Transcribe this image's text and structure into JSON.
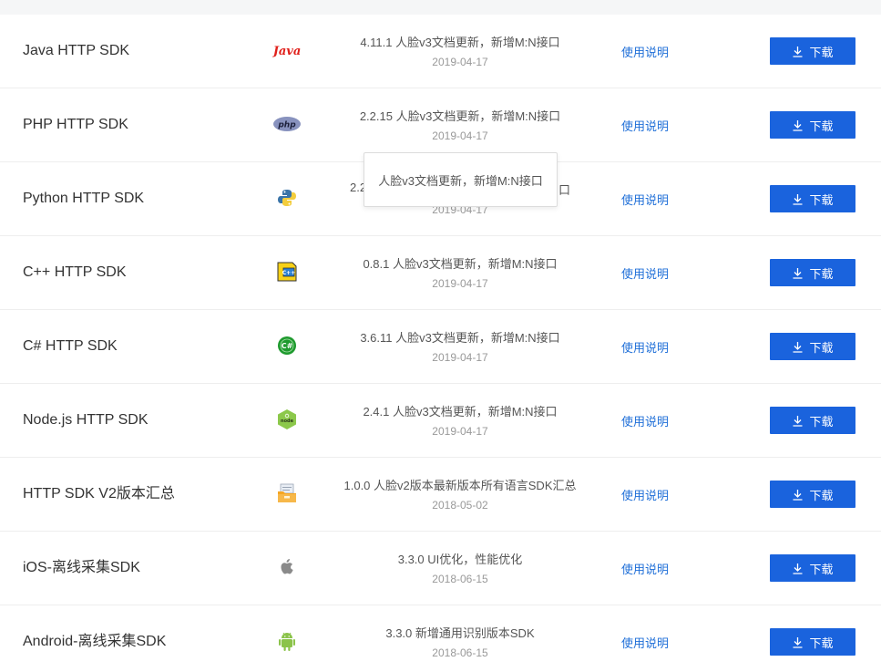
{
  "tooltip": {
    "text": "人脸v3文档更新，新增M:N接口"
  },
  "colors": {
    "primary": "#1a63dd",
    "link": "#1f6fd8",
    "date": "#999999"
  },
  "rows": [
    {
      "name": "Java HTTP SDK",
      "icon": "java-icon",
      "version": "4.11.1 人脸v3文档更新，新增M:N接口",
      "date": "2019-04-17",
      "doc": "使用说明",
      "download": "下载"
    },
    {
      "name": "PHP HTTP SDK",
      "icon": "php-icon",
      "version": "2.2.15 人脸v3文档更新，新增M:N接口",
      "date": "2019-04-17",
      "doc": "使用说明",
      "download": "下载"
    },
    {
      "name": "Python HTTP SDK",
      "icon": "python-icon",
      "version": "2.2.",
      "version_tail": "口",
      "date": "2019-04-17",
      "doc": "使用说明",
      "download": "下载"
    },
    {
      "name": "C++ HTTP SDK",
      "icon": "cpp-icon",
      "version": "0.8.1 人脸v3文档更新，新增M:N接口",
      "date": "2019-04-17",
      "doc": "使用说明",
      "download": "下载"
    },
    {
      "name": "C# HTTP SDK",
      "icon": "csharp-icon",
      "version": "3.6.11 人脸v3文档更新，新增M:N接口",
      "date": "2019-04-17",
      "doc": "使用说明",
      "download": "下载"
    },
    {
      "name": "Node.js HTTP SDK",
      "icon": "nodejs-icon",
      "version": "2.4.1 人脸v3文档更新，新增M:N接口",
      "date": "2019-04-17",
      "doc": "使用说明",
      "download": "下载"
    },
    {
      "name": "HTTP SDK V2版本汇总",
      "icon": "archive-icon",
      "version": "1.0.0 人脸v2版本最新版本所有语言SDK汇总",
      "date": "2018-05-02",
      "doc": "使用说明",
      "download": "下载"
    },
    {
      "name": "iOS-离线采集SDK",
      "icon": "apple-icon",
      "version": "3.3.0 UI优化，性能优化",
      "date": "2018-06-15",
      "doc": "使用说明",
      "download": "下载"
    },
    {
      "name": "Android-离线采集SDK",
      "icon": "android-icon",
      "version": "3.3.0 新增通用识别版本SDK",
      "date": "2018-06-15",
      "doc": "使用说明",
      "download": "下载"
    }
  ]
}
